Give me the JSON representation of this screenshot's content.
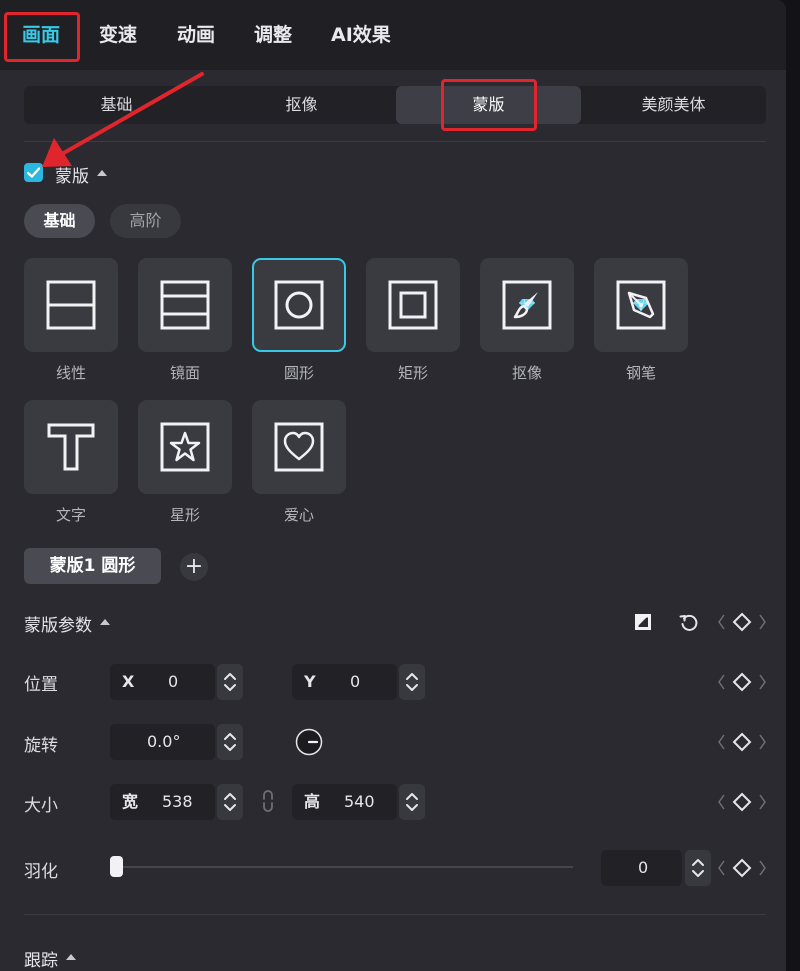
{
  "top_tabs": [
    {
      "label": "画面",
      "active": true
    },
    {
      "label": "变速",
      "active": false
    },
    {
      "label": "动画",
      "active": false
    },
    {
      "label": "调整",
      "active": false
    },
    {
      "label": "AI效果",
      "active": false
    }
  ],
  "sub_tabs": [
    {
      "label": "基础",
      "active": false
    },
    {
      "label": "抠像",
      "active": false
    },
    {
      "label": "蒙版",
      "active": true
    },
    {
      "label": "美颜美体",
      "active": false
    }
  ],
  "mask_section": {
    "enabled": true,
    "title": "蒙版",
    "modes": [
      {
        "label": "基础",
        "active": true
      },
      {
        "label": "高阶",
        "active": false
      }
    ],
    "shapes": [
      {
        "label": "线性",
        "icon": "linear-mask-icon",
        "selected": false,
        "premium": false
      },
      {
        "label": "镜面",
        "icon": "mirror-mask-icon",
        "selected": false,
        "premium": false
      },
      {
        "label": "圆形",
        "icon": "circle-mask-icon",
        "selected": true,
        "premium": false
      },
      {
        "label": "矩形",
        "icon": "rectangle-mask-icon",
        "selected": false,
        "premium": false
      },
      {
        "label": "抠像",
        "icon": "brush-mask-icon",
        "selected": false,
        "premium": true
      },
      {
        "label": "钢笔",
        "icon": "pen-mask-icon",
        "selected": false,
        "premium": true
      },
      {
        "label": "文字",
        "icon": "text-mask-icon",
        "selected": false,
        "premium": false
      },
      {
        "label": "星形",
        "icon": "star-mask-icon",
        "selected": false,
        "premium": false
      },
      {
        "label": "爱心",
        "icon": "heart-mask-icon",
        "selected": false,
        "premium": false
      }
    ],
    "active_mask": "蒙版1 圆形",
    "add_symbol": "+"
  },
  "params": {
    "title": "蒙版参数",
    "position": {
      "label": "位置",
      "x_prefix": "X",
      "x": "0",
      "y_prefix": "Y",
      "y": "0"
    },
    "rotation": {
      "label": "旋转",
      "value": "0.0°"
    },
    "size": {
      "label": "大小",
      "w_prefix": "宽",
      "w": "538",
      "h_prefix": "高",
      "h": "540"
    },
    "feather": {
      "label": "羽化",
      "value": "0",
      "level": 0
    }
  },
  "tracking": {
    "title": "跟踪"
  },
  "colors": {
    "accent": "#38c9e6",
    "annotation": "#e0262c",
    "premium_gem": "#5fd4f0"
  }
}
